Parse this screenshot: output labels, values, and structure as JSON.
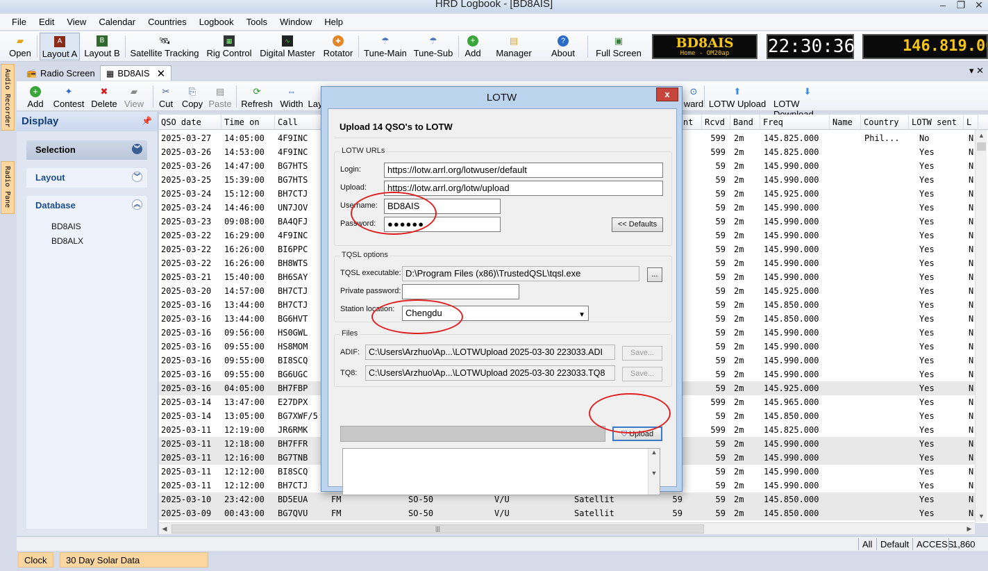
{
  "window": {
    "title": "HRD Logbook - [BD8AIS]"
  },
  "menu": [
    "File",
    "Edit",
    "View",
    "Calendar",
    "Countries",
    "Logbook",
    "Tools",
    "Window",
    "Help"
  ],
  "toolbar1": {
    "open": "Open",
    "layout_a": "Layout A",
    "layout_b": "Layout B",
    "satellite": "Satellite Tracking",
    "rig": "Rig Control",
    "dm": "Digital Master",
    "rotator": "Rotator",
    "tune_main": "Tune-Main",
    "tune_sub": "Tune-Sub",
    "add": "Add",
    "manager": "Manager",
    "about": "About",
    "full_screen": "Full Screen"
  },
  "displays": {
    "callsign": "BD8AIS",
    "callsign_sub": "Home - OM20ap",
    "time": "22:30:36",
    "frequency": "146.819.000"
  },
  "side_tabs": {
    "audio": "Audio Recorder",
    "radio": "Radio Pane"
  },
  "doc_tabs": {
    "radio_screen": "Radio Screen",
    "logbook": "BD8AIS"
  },
  "toolbar2": {
    "add": "Add",
    "contest": "Contest",
    "delete": "Delete",
    "view": "View",
    "cut": "Cut",
    "copy": "Copy",
    "paste": "Paste",
    "refresh": "Refresh",
    "width": "Width",
    "layout": "Lay",
    "forward": "ward",
    "lotw_upload": "LOTW Upload",
    "lotw_download": "LOTW Download"
  },
  "left_pane": {
    "title": "Display",
    "selection": "Selection",
    "layout": "Layout",
    "database": "Database",
    "db_items": [
      "BD8AIS",
      "BD8ALX"
    ]
  },
  "grid": {
    "headers": [
      "QSO date",
      "Time on",
      "Call",
      "nt",
      "Rcvd",
      "Band",
      "Freq",
      "Name",
      "Country",
      "LOTW sent",
      "L"
    ],
    "rows": [
      {
        "date": "2025-03-27",
        "time": "14:05:00",
        "call": "4F9INC",
        "nt": "9",
        "rcvd": "599",
        "band": "2m",
        "freq": "145.825.000",
        "country": "Phil...",
        "lotw": "No",
        "l": "N"
      },
      {
        "date": "2025-03-26",
        "time": "14:53:00",
        "call": "4F9INC",
        "nt": "9",
        "rcvd": "599",
        "band": "2m",
        "freq": "145.825.000",
        "country": "",
        "lotw": "Yes",
        "l": "N"
      },
      {
        "date": "2025-03-26",
        "time": "14:47:00",
        "call": "BG7HTS",
        "nt": "",
        "rcvd": "59",
        "band": "2m",
        "freq": "145.990.000",
        "country": "",
        "lotw": "Yes",
        "l": "N"
      },
      {
        "date": "2025-03-25",
        "time": "15:39:00",
        "call": "BG7HTS",
        "nt": "",
        "rcvd": "59",
        "band": "2m",
        "freq": "145.990.000",
        "country": "",
        "lotw": "Yes",
        "l": "N"
      },
      {
        "date": "2025-03-24",
        "time": "15:12:00",
        "call": "BH7CTJ",
        "nt": "",
        "rcvd": "59",
        "band": "2m",
        "freq": "145.925.000",
        "country": "",
        "lotw": "Yes",
        "l": "N"
      },
      {
        "date": "2025-03-24",
        "time": "14:46:00",
        "call": "UN7JOV",
        "nt": "",
        "rcvd": "59",
        "band": "2m",
        "freq": "145.990.000",
        "country": "",
        "lotw": "Yes",
        "l": "N"
      },
      {
        "date": "2025-03-23",
        "time": "09:08:00",
        "call": "BA4QFJ",
        "nt": "",
        "rcvd": "59",
        "band": "2m",
        "freq": "145.990.000",
        "country": "",
        "lotw": "Yes",
        "l": "N"
      },
      {
        "date": "2025-03-22",
        "time": "16:29:00",
        "call": "4F9INC",
        "nt": "",
        "rcvd": "59",
        "band": "2m",
        "freq": "145.990.000",
        "country": "",
        "lotw": "Yes",
        "l": "N"
      },
      {
        "date": "2025-03-22",
        "time": "16:26:00",
        "call": "BI6PPC",
        "nt": "",
        "rcvd": "59",
        "band": "2m",
        "freq": "145.990.000",
        "country": "",
        "lotw": "Yes",
        "l": "N"
      },
      {
        "date": "2025-03-22",
        "time": "16:26:00",
        "call": "BH8WTS",
        "nt": "",
        "rcvd": "59",
        "band": "2m",
        "freq": "145.990.000",
        "country": "",
        "lotw": "Yes",
        "l": "N"
      },
      {
        "date": "2025-03-21",
        "time": "15:40:00",
        "call": "BH6SAY",
        "nt": "",
        "rcvd": "59",
        "band": "2m",
        "freq": "145.990.000",
        "country": "",
        "lotw": "Yes",
        "l": "N"
      },
      {
        "date": "2025-03-20",
        "time": "14:57:00",
        "call": "BH7CTJ",
        "nt": "",
        "rcvd": "59",
        "band": "2m",
        "freq": "145.925.000",
        "country": "",
        "lotw": "Yes",
        "l": "N"
      },
      {
        "date": "2025-03-16",
        "time": "13:44:00",
        "call": "BH7CTJ",
        "nt": "",
        "rcvd": "59",
        "band": "2m",
        "freq": "145.850.000",
        "country": "",
        "lotw": "Yes",
        "l": "N"
      },
      {
        "date": "2025-03-16",
        "time": "13:44:00",
        "call": "BG6HVT",
        "nt": "",
        "rcvd": "59",
        "band": "2m",
        "freq": "145.850.000",
        "country": "",
        "lotw": "Yes",
        "l": "N"
      },
      {
        "date": "2025-03-16",
        "time": "09:56:00",
        "call": "HS0GWL",
        "nt": "",
        "rcvd": "59",
        "band": "2m",
        "freq": "145.990.000",
        "country": "",
        "lotw": "Yes",
        "l": "N"
      },
      {
        "date": "2025-03-16",
        "time": "09:55:00",
        "call": "HS8MOM",
        "nt": "",
        "rcvd": "59",
        "band": "2m",
        "freq": "145.990.000",
        "country": "",
        "lotw": "Yes",
        "l": "N"
      },
      {
        "date": "2025-03-16",
        "time": "09:55:00",
        "call": "BI8SCQ",
        "nt": "",
        "rcvd": "59",
        "band": "2m",
        "freq": "145.990.000",
        "country": "",
        "lotw": "Yes",
        "l": "N"
      },
      {
        "date": "2025-03-16",
        "time": "09:55:00",
        "call": "BG6UGC",
        "nt": "",
        "rcvd": "59",
        "band": "2m",
        "freq": "145.990.000",
        "country": "",
        "lotw": "Yes",
        "l": "N"
      },
      {
        "date": "2025-03-16",
        "time": "04:05:00",
        "call": "BH7FBP",
        "nt": "",
        "rcvd": "59",
        "band": "2m",
        "freq": "145.925.000",
        "country": "",
        "lotw": "Yes",
        "l": "N"
      },
      {
        "date": "2025-03-14",
        "time": "13:47:00",
        "call": "E27DPX",
        "nt": "9",
        "rcvd": "599",
        "band": "2m",
        "freq": "145.965.000",
        "country": "",
        "lotw": "Yes",
        "l": "N"
      },
      {
        "date": "2025-03-14",
        "time": "13:05:00",
        "call": "BG7XWF/5",
        "nt": "",
        "rcvd": "59",
        "band": "2m",
        "freq": "145.850.000",
        "country": "",
        "lotw": "Yes",
        "l": "N"
      },
      {
        "date": "2025-03-11",
        "time": "12:19:00",
        "call": "JR6RMK",
        "nt": "9",
        "rcvd": "599",
        "band": "2m",
        "freq": "145.825.000",
        "country": "",
        "lotw": "Yes",
        "l": "N"
      },
      {
        "date": "2025-03-11",
        "time": "12:18:00",
        "call": "BH7FFR",
        "nt": "",
        "rcvd": "59",
        "band": "2m",
        "freq": "145.990.000",
        "country": "",
        "lotw": "Yes",
        "l": "N"
      },
      {
        "date": "2025-03-11",
        "time": "12:16:00",
        "call": "BG7TNB",
        "nt": "",
        "rcvd": "59",
        "band": "2m",
        "freq": "145.990.000",
        "country": "",
        "lotw": "Yes",
        "l": "N"
      },
      {
        "date": "2025-03-11",
        "time": "12:12:00",
        "call": "BI8SCQ",
        "nt": "",
        "rcvd": "59",
        "band": "2m",
        "freq": "145.990.000",
        "country": "",
        "lotw": "Yes",
        "l": "N"
      },
      {
        "date": "2025-03-11",
        "time": "12:12:00",
        "call": "BH7CTJ",
        "nt": "",
        "rcvd": "59",
        "band": "2m",
        "freq": "145.990.000",
        "country": "",
        "lotw": "Yes",
        "l": "N"
      },
      {
        "date": "2025-03-10",
        "time": "23:42:00",
        "call": "BD5EUA",
        "mode": "FM",
        "sat": "SO-50",
        "satmode": "V/U",
        "prop": "Satellit",
        "nt": "59",
        "rcvd": "59",
        "band": "2m",
        "freq": "145.850.000",
        "country": "",
        "lotw": "Yes",
        "l": "N"
      },
      {
        "date": "2025-03-09",
        "time": "00:43:00",
        "call": "BG7QVU",
        "mode": "FM",
        "sat": "SO-50",
        "satmode": "V/U",
        "prop": "Satellit",
        "nt": "59",
        "rcvd": "59",
        "band": "2m",
        "freq": "145.850.000",
        "country": "",
        "lotw": "Yes",
        "l": "N"
      }
    ]
  },
  "status_bar": {
    "all": "All",
    "default": "Default",
    "access": "ACCESS",
    "count": "1,860"
  },
  "bottom_tabs": {
    "clock": "Clock",
    "solar": "30 Day Solar Data"
  },
  "dialog": {
    "title": "LOTW",
    "close": "x",
    "heading": "Upload 14 QSO's to LOTW",
    "urls_legend": "LOTW URLs",
    "login_label": "Login:",
    "login_value": "https://lotw.arrl.org/lotwuser/default",
    "upload_label": "Upload:",
    "upload_value": "https://lotw.arrl.org/lotw/upload",
    "username_label": "Username:",
    "username_value": "BD8AIS",
    "password_label": "Password:",
    "password_value": "●●●●●●",
    "defaults_button": "<< Defaults",
    "tqsl_legend": "TQSL options",
    "tqsl_exe_label": "TQSL executable:",
    "tqsl_exe_value": "D:\\Program Files (x86)\\TrustedQSL\\tqsl.exe",
    "browse_button": "...",
    "private_pw_label": "Private password:",
    "private_pw_value": "",
    "station_label": "Station location:",
    "station_value": "Chengdu",
    "files_legend": "Files",
    "adif_label": "ADIF:",
    "adif_value": "C:\\Users\\Arzhuo\\Ap...\\LOTWUpload 2025-03-30 223033.ADI",
    "tq8_label": "TQ8:",
    "tq8_value": "C:\\Users\\Arzhuo\\Ap...\\LOTWUpload 2025-03-30 223033.TQ8",
    "save_button": "Save...",
    "upload_button": "Upload"
  }
}
